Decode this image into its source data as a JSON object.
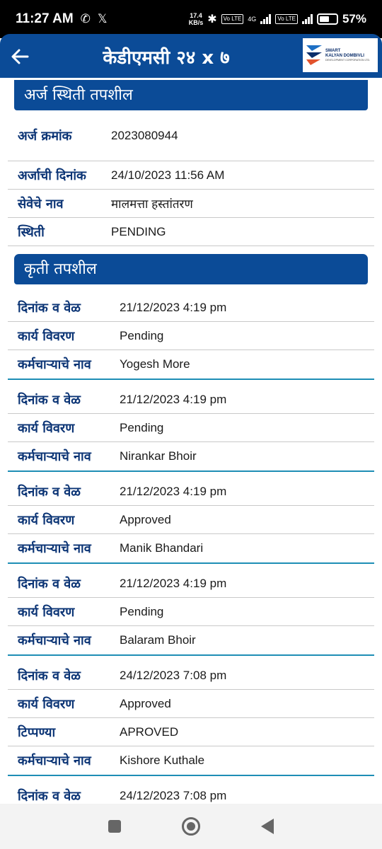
{
  "status_bar": {
    "time": "11:27 AM",
    "speed": "17.4",
    "speed_unit": "KB/s",
    "network": "4G",
    "volte1": "Vo LTE",
    "volte2": "Vo LTE",
    "battery_percent": "57%",
    "battery_level": 0.57
  },
  "app_bar": {
    "title": "केडीएमसी २४ x ७",
    "logo_line1": "SMART",
    "logo_line2": "KALYAN DOMBIVLI",
    "logo_line3": "DEVELOPMENT CORPORATION LTD."
  },
  "application": {
    "heading": "अर्ज स्थिती तपशील",
    "rows": [
      {
        "label": "अर्ज क्रमांक",
        "value": "2023080944"
      },
      {
        "label": "अर्जाची दिनांक",
        "value": "24/10/2023 11:56 AM"
      },
      {
        "label": "सेवेचे नाव",
        "value": "मालमत्ता हस्तांतरण"
      },
      {
        "label": "स्थिती",
        "value": "PENDING"
      }
    ]
  },
  "actions": {
    "heading": "कृती तपशील",
    "groups": [
      {
        "rows": [
          {
            "label": "दिनांक व वेळ",
            "value": "21/12/2023 4:19 pm"
          },
          {
            "label": "कार्य विवरण",
            "value": "Pending"
          },
          {
            "label": "कर्मचाऱ्याचे नाव",
            "value": "Yogesh More"
          }
        ]
      },
      {
        "rows": [
          {
            "label": "दिनांक व वेळ",
            "value": "21/12/2023 4:19 pm"
          },
          {
            "label": "कार्य विवरण",
            "value": "Pending"
          },
          {
            "label": "कर्मचाऱ्याचे नाव",
            "value": "Nirankar Bhoir"
          }
        ]
      },
      {
        "rows": [
          {
            "label": "दिनांक व वेळ",
            "value": "21/12/2023 4:19 pm"
          },
          {
            "label": "कार्य विवरण",
            "value": "Approved"
          },
          {
            "label": "कर्मचाऱ्याचे नाव",
            "value": "Manik Bhandari"
          }
        ]
      },
      {
        "rows": [
          {
            "label": "दिनांक व वेळ",
            "value": "21/12/2023 4:19 pm"
          },
          {
            "label": "कार्य विवरण",
            "value": "Pending"
          },
          {
            "label": "कर्मचाऱ्याचे नाव",
            "value": "Balaram Bhoir"
          }
        ]
      },
      {
        "rows": [
          {
            "label": "दिनांक व वेळ",
            "value": "24/12/2023 7:08 pm"
          },
          {
            "label": "कार्य विवरण",
            "value": "Approved"
          },
          {
            "label": "टिप्पण्या",
            "value": "APROVED"
          },
          {
            "label": "कर्मचाऱ्याचे नाव",
            "value": "Kishore Kuthale"
          }
        ]
      },
      {
        "rows": [
          {
            "label": "दिनांक व वेळ",
            "value": "24/12/2023 7:08 pm"
          }
        ]
      }
    ]
  },
  "colors": {
    "primary": "#0b4b97",
    "label": "#0b3475",
    "divider_accent": "#1e8eb5"
  }
}
